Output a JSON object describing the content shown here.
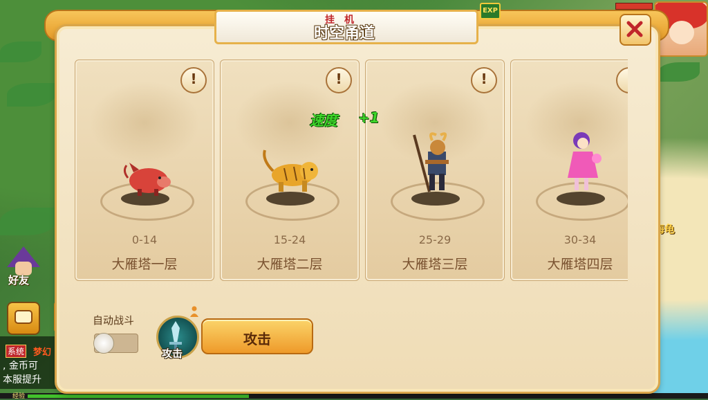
{
  "panel": {
    "title": "时空甬道",
    "title_overlay": "挂机",
    "exp_badge": "EXP",
    "close_icon": "close-x-icon"
  },
  "cards": [
    {
      "level": "0-14",
      "floor": "大雁塔一层",
      "monster": "red-boar",
      "info": "!"
    },
    {
      "level": "15-24",
      "floor": "大雁塔二层",
      "monster": "golden-tiger",
      "info": "!"
    },
    {
      "level": "25-29",
      "floor": "大雁塔三层",
      "monster": "goat-warrior",
      "info": "!"
    },
    {
      "level": "30-34",
      "floor": "大雁塔四层",
      "monster": "pink-fairy",
      "info": "!"
    }
  ],
  "buff": {
    "label": "速度",
    "value": "+1"
  },
  "controls": {
    "auto_battle_label": "自动战斗",
    "auto_battle_on": false,
    "skill_label": "攻击",
    "attack_button": "攻击"
  },
  "hud": {
    "friend_label": "好友",
    "chat_tag": "系统",
    "chat_name": "梦幻",
    "chat_lines": [
      ", 金币可",
      "本服提升"
    ],
    "xp_label": "经验",
    "side_label": "海龟"
  },
  "colors": {
    "accent": "#e59a27",
    "buff_green": "#3ed62a",
    "close_red": "#c0262b"
  }
}
